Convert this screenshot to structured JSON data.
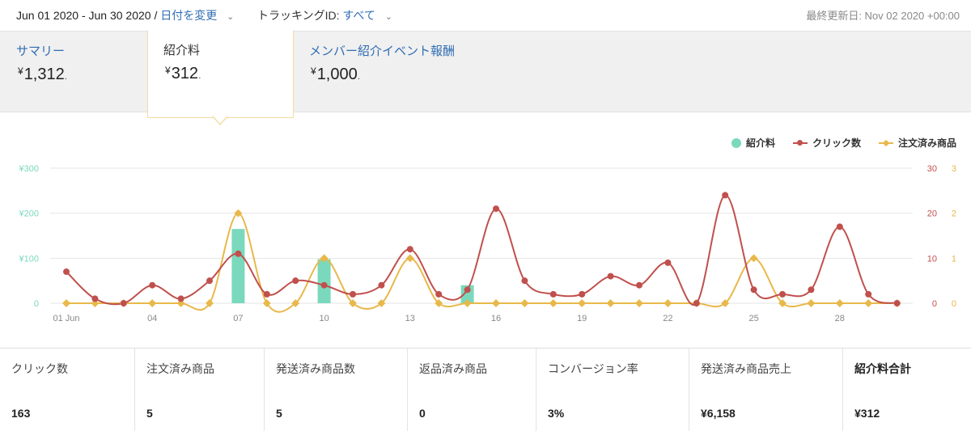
{
  "topbar": {
    "date_range": "Jun 01 2020 - Jun 30 2020 /",
    "change_date": "日付を変更",
    "tracking_label": "トラッキングID:",
    "tracking_value": "すべて",
    "last_updated": "最終更新日: Nov 02 2020 +00:00"
  },
  "tabs": [
    {
      "label": "サマリー",
      "currency": "¥",
      "value": "1,312",
      "suffix": "."
    },
    {
      "label": "紹介料",
      "currency": "¥",
      "value": "312",
      "suffix": "."
    },
    {
      "label": "メンバー紹介イベント報酬",
      "currency": "¥",
      "value": "1,000",
      "suffix": "."
    }
  ],
  "legend": {
    "fee": "紹介料",
    "clicks": "クリック数",
    "ordered": "注文済み商品"
  },
  "colors": {
    "fee": "#7ad9bd",
    "clicks": "#c0504d",
    "ordered": "#e8b84a",
    "link": "#2f6db3"
  },
  "chart_data": {
    "type": "bar+line",
    "x": [
      "01 Jun",
      "02",
      "03",
      "04",
      "05",
      "06",
      "07",
      "08",
      "09",
      "10",
      "11",
      "12",
      "13",
      "14",
      "15",
      "16",
      "17",
      "18",
      "19",
      "20",
      "21",
      "22",
      "23",
      "24",
      "25",
      "26",
      "27",
      "28",
      "29",
      "30"
    ],
    "x_tick_labels": [
      "01 Jun",
      "04",
      "07",
      "10",
      "13",
      "16",
      "19",
      "22",
      "25",
      "28"
    ],
    "y_left": {
      "ticks": [
        "¥300",
        "¥200",
        "¥100",
        "0"
      ],
      "range": [
        0,
        300
      ]
    },
    "y_right_clicks": {
      "ticks": [
        "30",
        "20",
        "10",
        "0"
      ],
      "range": [
        0,
        30
      ]
    },
    "y_right_orders": {
      "ticks": [
        "3",
        "2",
        "1",
        "0"
      ],
      "range": [
        0,
        3
      ]
    },
    "series": [
      {
        "name": "紹介料",
        "kind": "bar",
        "axis": "left",
        "values": [
          0,
          0,
          0,
          0,
          0,
          0,
          165,
          0,
          0,
          98,
          0,
          0,
          0,
          0,
          40,
          0,
          0,
          0,
          0,
          0,
          0,
          0,
          0,
          0,
          0,
          0,
          0,
          0,
          0,
          0
        ]
      },
      {
        "name": "クリック数",
        "kind": "line",
        "axis": "clicks",
        "values": [
          7,
          1,
          0,
          4,
          1,
          5,
          11,
          2,
          5,
          4,
          2,
          4,
          12,
          2,
          3,
          21,
          5,
          2,
          2,
          6,
          4,
          9,
          0,
          24,
          3,
          2,
          3,
          17,
          2,
          0
        ]
      },
      {
        "name": "注文済み商品",
        "kind": "line",
        "axis": "orders",
        "values": [
          0,
          0,
          0,
          0,
          0,
          0,
          2,
          0,
          0,
          1,
          0,
          0,
          1,
          0,
          0,
          0,
          0,
          0,
          0,
          0,
          0,
          0,
          0,
          0,
          1,
          0,
          0,
          0,
          0,
          0
        ]
      }
    ]
  },
  "stats": [
    {
      "label": "クリック数",
      "value": "163"
    },
    {
      "label": "注文済み商品",
      "value": "5"
    },
    {
      "label": "発送済み商品数",
      "value": "5"
    },
    {
      "label": "返品済み商品",
      "value": "0"
    },
    {
      "label": "コンバージョン率",
      "value": "3%"
    },
    {
      "label": "発送済み商品売上",
      "value": "¥6,158"
    },
    {
      "label": "紹介料合計",
      "value": "¥312"
    }
  ]
}
